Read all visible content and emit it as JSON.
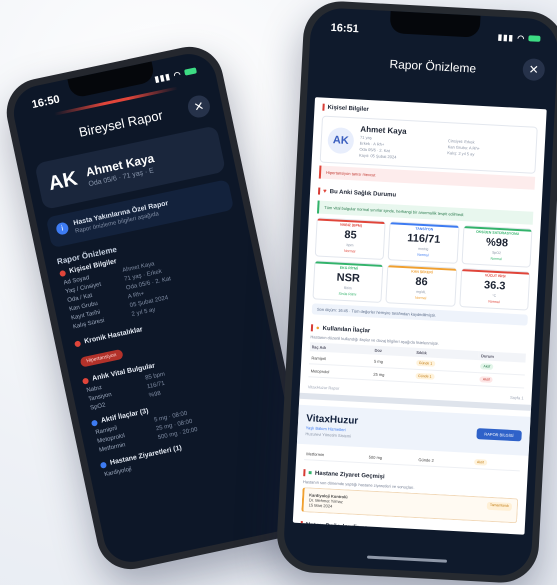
{
  "left_phone": {
    "status_time": "16:50",
    "title": "Bireysel Rapor",
    "patient": {
      "initials": "AK",
      "name": "Ahmet Kaya",
      "sub": "Oda 05/6 · 71 yaş · E"
    },
    "info_box": {
      "title": "Hasta Yakınlarına Özel Rapor",
      "text": "Rapor önizleme bilgileri aşağıda"
    },
    "section_title": "Rapor Önizleme",
    "personal": {
      "title": "Kişisel Bilgiler",
      "rows": [
        {
          "k": "Ad Soyad",
          "v": "Ahmet Kaya"
        },
        {
          "k": "Yaş / Cinsiyet",
          "v": "71 yaş · Erkek"
        },
        {
          "k": "Oda / Kat",
          "v": "Oda 05/6 · 2. Kat"
        },
        {
          "k": "Kan Grubu",
          "v": "A Rh+"
        },
        {
          "k": "Kayıt Tarihi",
          "v": "05 Şubat 2024"
        },
        {
          "k": "Kalış Süresi",
          "v": "2 yıl 5 ay"
        }
      ]
    },
    "chronic": {
      "title": "Kronik Hastalıklar",
      "pill": "Hipertansiyon"
    },
    "vitals": {
      "title": "Anlık Vital Bulgular",
      "rows": [
        {
          "k": "Nabız",
          "v": "85 bpm"
        },
        {
          "k": "Tansiyon",
          "v": "116/71"
        },
        {
          "k": "SpO2",
          "v": "%98"
        }
      ]
    },
    "meds": {
      "title": "Aktif İlaçlar (3)",
      "rows": [
        {
          "k": "Ramipril",
          "v": "5 mg · 08:00"
        },
        {
          "k": "Metoprolol",
          "v": "25 mg · 08:00"
        },
        {
          "k": "Metformin",
          "v": "500 mg · 20:00"
        }
      ]
    },
    "visits": {
      "title": "Hastane Ziyaretleri (1)",
      "sub": "Kardiyoloji"
    }
  },
  "right_phone": {
    "status_time": "16:51",
    "title": "Rapor Önizleme",
    "personal_title": "Kişisel Bilgiler",
    "patient": {
      "initials": "AK",
      "name": "Ahmet Kaya",
      "lines": [
        "71 yaş",
        "Erkek · A Rh+",
        "Oda 05/6 · 2. Kat",
        "Kayıt: 05 Şubat 2024"
      ],
      "lines_right": [
        "Cinsiyet: Erkek",
        "Kan Grubu: A Rh+",
        "Kalış: 2 yıl 5 ay"
      ]
    },
    "alert": "Hipertansiyon tanısı mevcut",
    "health_title": "Bu Anki Sağlık Durumu",
    "health_note": "Tüm vital bulgular normal sınırlar içinde, herhangi bir anormallik tespit edilmedi.",
    "vitals": [
      {
        "label": "NABIZ (BPM)",
        "value": "85",
        "unit": "bpm",
        "status": "Normal",
        "color": "#e0453a"
      },
      {
        "label": "TANSİYON",
        "value": "116/71",
        "unit": "mmHg",
        "status": "Normal",
        "color": "#3d7bf2"
      },
      {
        "label": "OKSİJEN SATÜRASYONU",
        "value": "%98",
        "unit": "SpO2",
        "status": "Normal",
        "color": "#33b36b"
      },
      {
        "label": "EKG RİTMİ",
        "value": "NSR",
        "unit": "Ritim",
        "status": "Sinüs Ritmi",
        "color": "#33b36b"
      },
      {
        "label": "KAN ŞEKERİ",
        "value": "86",
        "unit": "mg/dL",
        "status": "Normal",
        "color": "#f0a030"
      },
      {
        "label": "VÜCUT ISISI",
        "value": "36.3",
        "unit": "°C",
        "status": "Normal",
        "color": "#e0453a"
      }
    ],
    "info_note": "Son ölçüm: 16:45 · Tüm değerler hemşire tarafından kaydedilmiştir.",
    "meds_title": "Kullanılan İlaçlar",
    "meds_text": "Hastanın düzenli kullandığı ilaçlar ve dozaj bilgileri aşağıda listelenmiştir.",
    "meds_columns": [
      "İlaç Adı",
      "Doz",
      "Sıklık",
      "Durum"
    ],
    "meds_rows": [
      {
        "name": "Ramipril",
        "dose": "5 mg",
        "freq": "Günde 1",
        "state": "Aktif"
      },
      {
        "name": "Metoprolol",
        "dose": "25 mg",
        "freq": "Günde 1",
        "state": "Aktif"
      }
    ],
    "footer_left": "VitaxHuzur Rapor",
    "footer_right": "Sayfa 1",
    "brand": {
      "name": "VitaxHuzur",
      "tag": "Yaşlı Bakım Hizmetleri",
      "sub": "Huzurevi Yönetim Sistemi",
      "button": "RAPOR BİLGİSİ"
    },
    "meds_row_extra": {
      "name": "Metformin",
      "dose": "500 mg",
      "freq": "Günde 2",
      "state": "Aktif"
    },
    "visit_title": "Hastane Ziyaret Geçmişi",
    "visit_text": "Hastanın son dönemde yaptığı hastane ziyaretleri ve sonuçları.",
    "visit_item": {
      "title": "Kardiyoloji Kontrolü",
      "sub": "Dr. Mehmet Yılmaz",
      "date": "15 Mart 2024",
      "status": "Tamamlandı"
    },
    "bottom_section": "Not ve Değerlendirme"
  }
}
